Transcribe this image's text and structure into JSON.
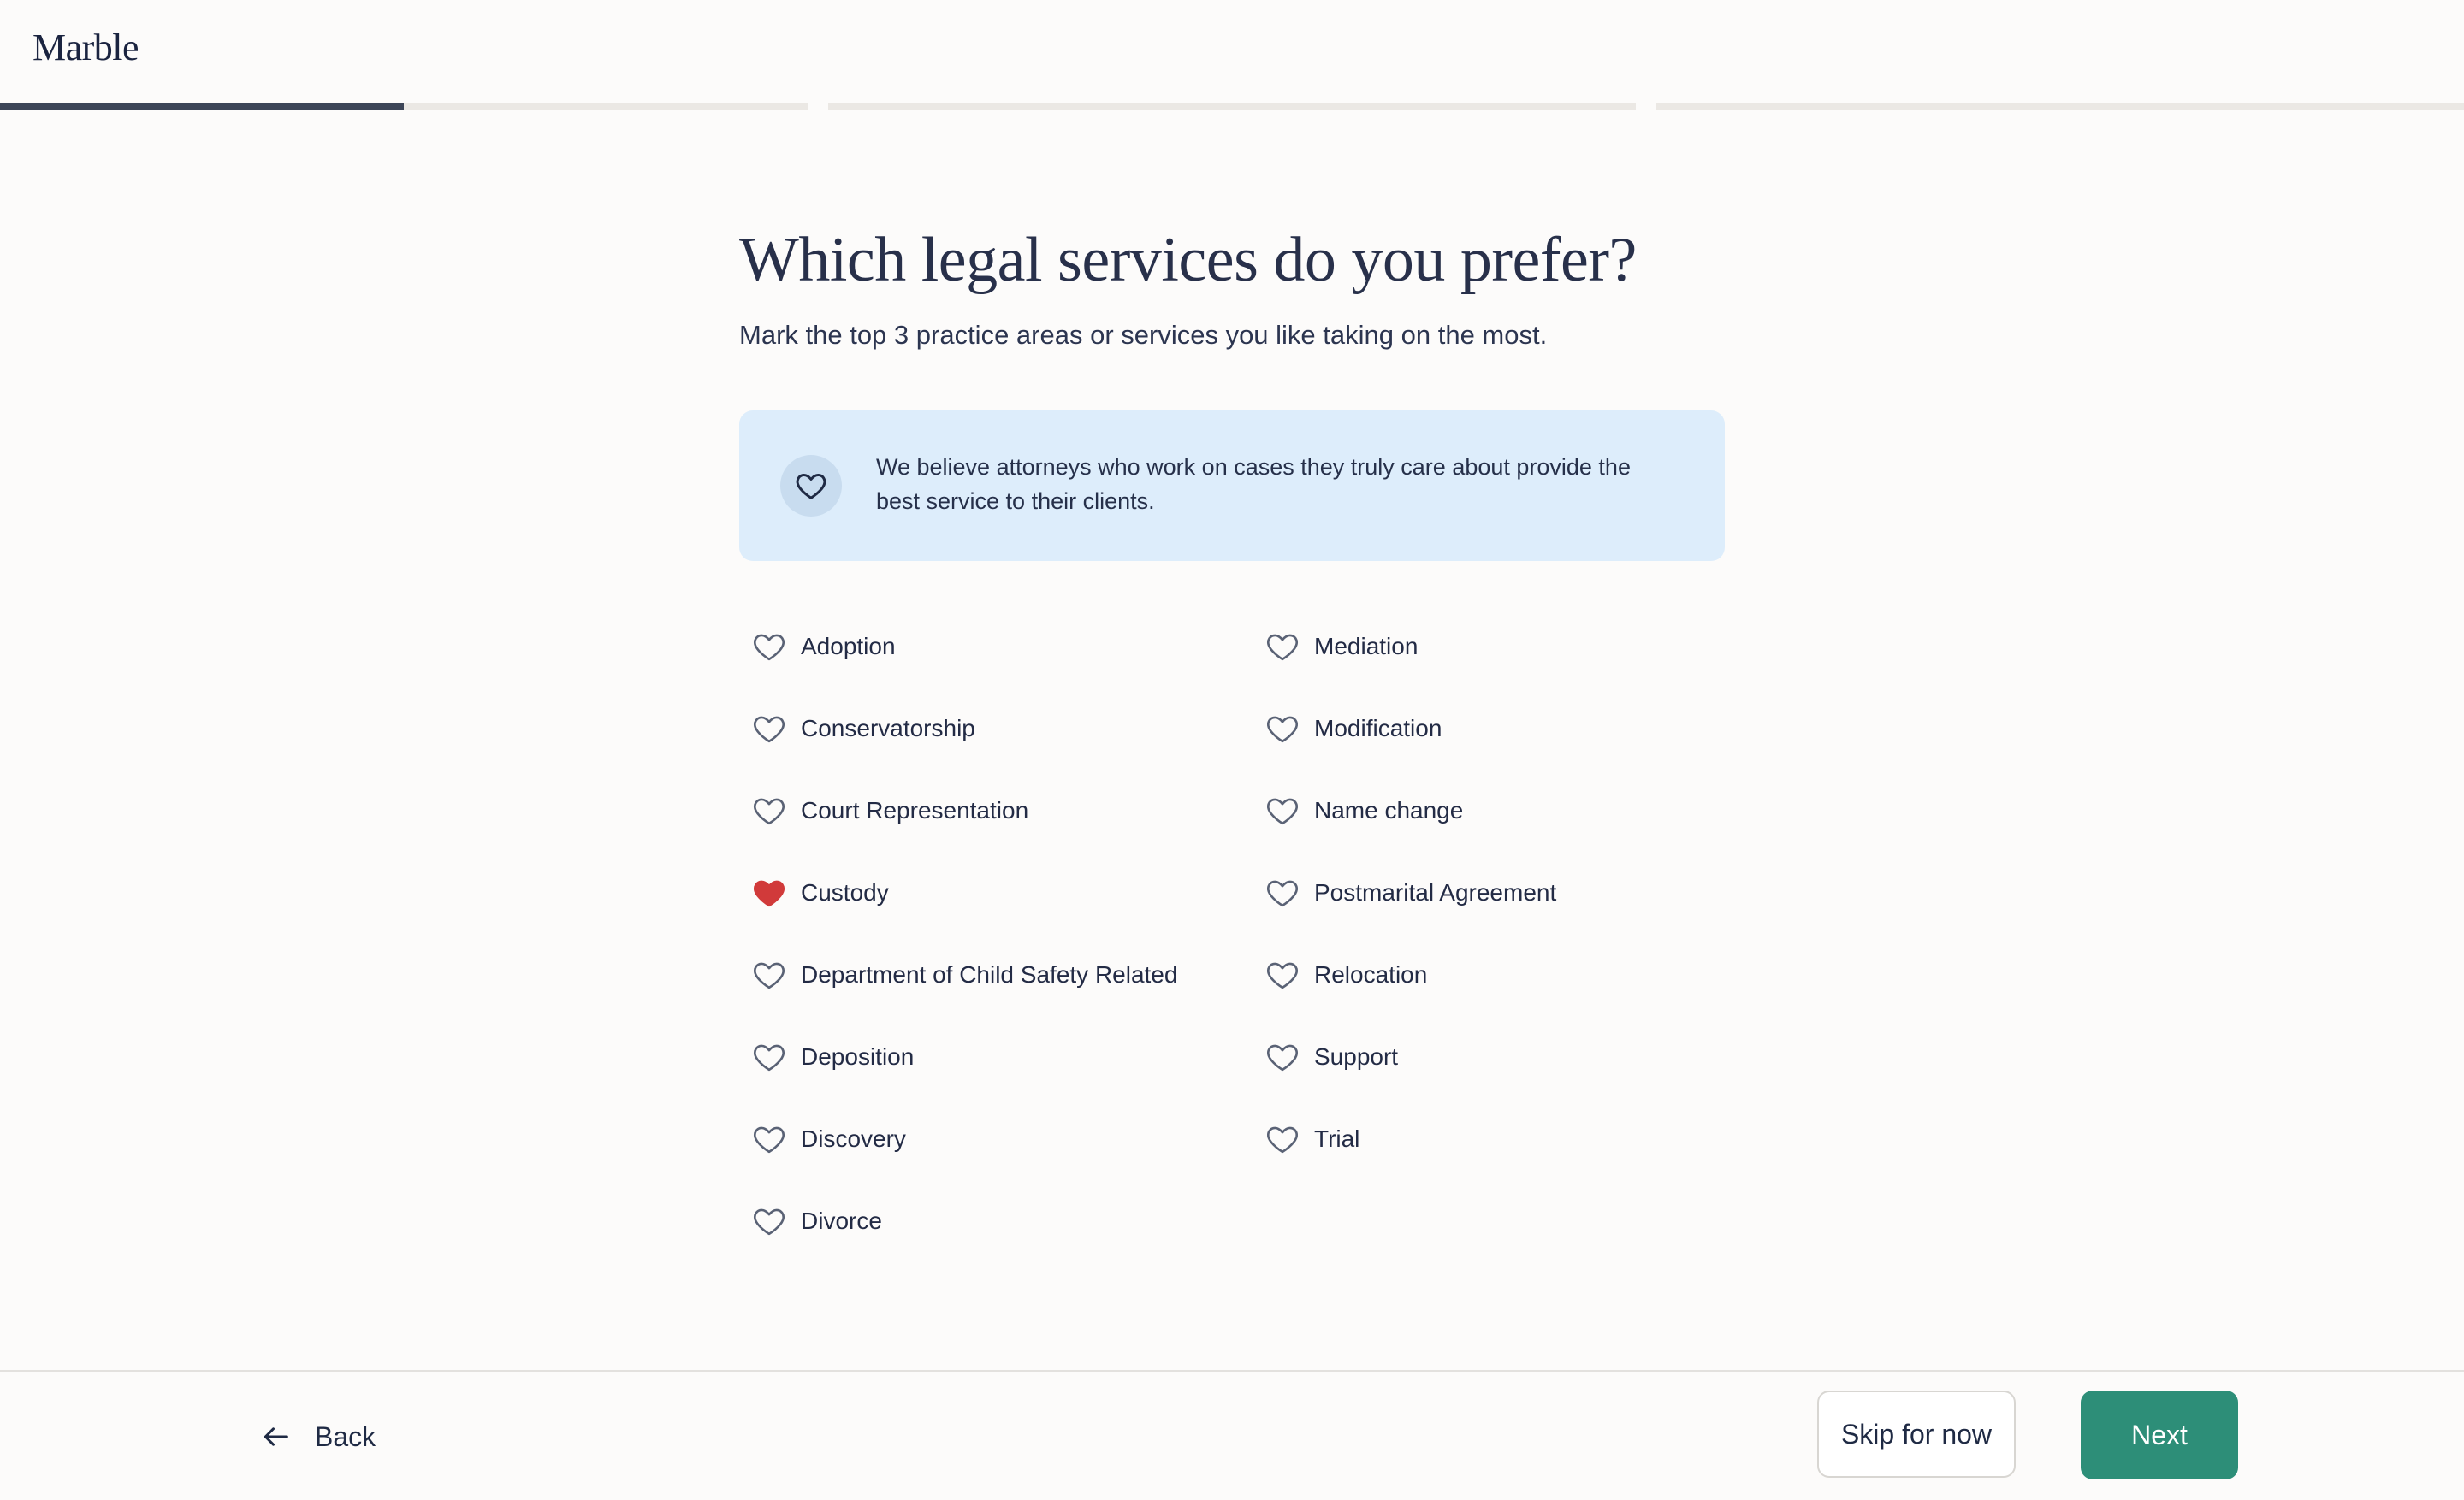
{
  "header": {
    "logo": "Marble"
  },
  "progress": {
    "segments": [
      0.5,
      0,
      0
    ],
    "color_filled": "#3d4557",
    "color_track": "#ebe8e4"
  },
  "main": {
    "title": "Which legal services do you prefer?",
    "subtitle": "Mark the top 3 practice areas or services you like taking on the most.",
    "callout": {
      "icon": "heart-icon",
      "text": "We believe attorneys who work on cases they truly care about provide the best service to their clients."
    },
    "options_left": [
      {
        "label": "Adoption",
        "selected": false
      },
      {
        "label": "Conservatorship",
        "selected": false
      },
      {
        "label": "Court Representation",
        "selected": false
      },
      {
        "label": "Custody",
        "selected": true
      },
      {
        "label": "Department of Child Safety Related",
        "selected": false
      },
      {
        "label": "Deposition",
        "selected": false
      },
      {
        "label": "Discovery",
        "selected": false
      },
      {
        "label": "Divorce",
        "selected": false
      }
    ],
    "options_right": [
      {
        "label": "Mediation",
        "selected": false
      },
      {
        "label": "Modification",
        "selected": false
      },
      {
        "label": "Name change",
        "selected": false
      },
      {
        "label": "Postmarital Agreement",
        "selected": false
      },
      {
        "label": "Relocation",
        "selected": false
      },
      {
        "label": "Support",
        "selected": false
      },
      {
        "label": "Trial",
        "selected": false
      }
    ]
  },
  "footer": {
    "back_label": "Back",
    "skip_label": "Skip for now",
    "next_label": "Next"
  },
  "colors": {
    "accent": "#2d8e78",
    "heart_selected": "#d13a3a",
    "heart_outline": "#5a6275",
    "callout_bg": "#ddedfb"
  }
}
